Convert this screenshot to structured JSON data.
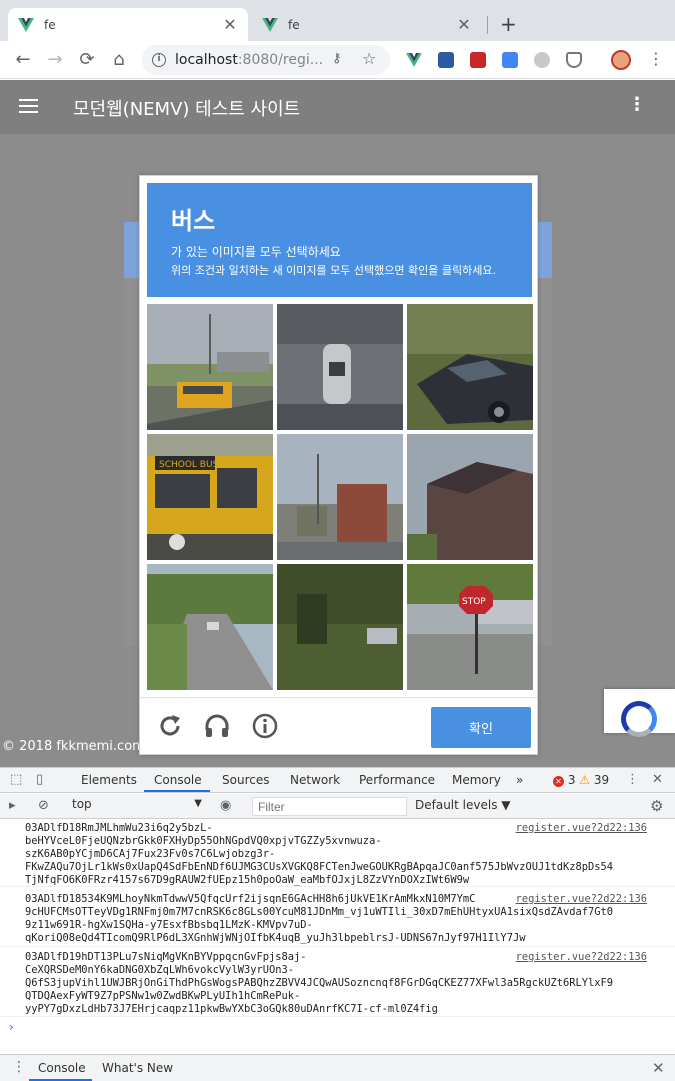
{
  "browser": {
    "tabs": [
      {
        "title": "fe",
        "active": true
      },
      {
        "title": "fe",
        "active": false
      }
    ],
    "new_tab_label": "+",
    "url_host": "localhost",
    "url_path": ":8080/regi...",
    "back_label": "←",
    "forward_label": "→",
    "reload_label": "⟳",
    "home_label": "⌂"
  },
  "app": {
    "title": "모던웹(NEMV) 테스트 사이트",
    "footer": "© 2018 fkkmemi.com"
  },
  "captcha": {
    "object": "버스",
    "instruction": "가 있는 이미지를 모두 선택하세요",
    "sub_instruction": "위의 조건과 일치하는 새 이미지를 모두 선택했으면 확인을 클릭하세요.",
    "verify_label": "확인",
    "tiles": [
      "bus-road",
      "fire-hydrant",
      "parked-car",
      "school-bus",
      "street-buildings",
      "house-roof",
      "winding-road",
      "trees-car",
      "stop-sign"
    ],
    "stop_sign_text": "STOP",
    "school_bus_text": "SCHOOL BUS"
  },
  "devtools": {
    "tabs": [
      "Elements",
      "Console",
      "Sources",
      "Network",
      "Performance",
      "Memory"
    ],
    "more": "»",
    "errors": "3",
    "warnings": "39",
    "context": "top",
    "filter_placeholder": "Filter",
    "levels": "Default levels ▼",
    "logs": [
      {
        "source": "register.vue?2d22:136",
        "text": "03ADlfD18RmJMLhmWu23i6q2y5bzL-\nbeHYVceL0FjeUQNzbrGkk0FXHyDp55OhNGpdVQ0xpjvTGZZy5xvnwuza-\nszK6AB0pYCjmD6CAj7Fux23Fv0s7C6Lwjobzg3r-\nFKwZAQu7OjLr1kWs0xUapQ4SdFbEnNDf6UJMG3CUsXVGKQ8FCTenJweGOUKRgBApqaJC0anf575JbWvzOUJ1tdKz8pDs54\nTjNfqFO6K0FRzr4157s67D9gRAUW2fUEpz15h0poOaW_eaMbfOJxjL8ZzVYnDOXzIWt6W9w"
      },
      {
        "source": "register.vue?2d22:136",
        "text": "03ADlfD18534K9MLhoyNkmTdwwV5QfqcUrf2ijsqnE6GAcHH8h6jUkVE1KrAmMkxN10M7YmC\n9cHUFCMsOTTeyVDg1RNFmj0m7M7cnRSK6c8GLs00YcuM81JDnMm_vj1uWTIli_30xD7mEhUHtyxUA1sixQsdZAvdaf7Gt0\n9z11w691R-hgXw1SQHa-y7EsxfBbsbq1LMzK-KMVpv7uD-\nqKoriQ08eQd4TIcomQ9RlP6dL3XGnhWjWNjOIfbK4uqB_yuJh3lbpeblrsJ-UDNS67nJyf97H1IlY7Jw"
      },
      {
        "source": "register.vue?2d22:136",
        "text": "03ADlfD19hDT13PLu7sNiqMgVKnBYVppqcnGvFpjs8aj-\nCeXQRSDeM0nY6kaDNG0XbZqLWh6vokcVylW3yrUOn3-\nQ6fS3jupVihl1UWJBRjOnGiThdPhGsWogsPABQhzZBVV4JCQwAUSozncnqf8FGrDGqCKEZ77XFwl3a5RgckUZt6RLYlxF9\nQTDQAexFyWT9Z7pPSNw1w0ZwdBKwPLyUIh1hCmRePuk-\nyyPY7gDxzLdHb73J7EHrjcaqpz11pkwBwYXbC3oGQk80uDAnrfKC7I-cf-ml0Z4fig"
      }
    ],
    "drawer_tabs": [
      "Console",
      "What's New"
    ]
  },
  "colors": {
    "captcha_blue": "#4a90e2",
    "page_overlay": "#8c8c8c",
    "devtools_accent": "#1a73e8"
  }
}
